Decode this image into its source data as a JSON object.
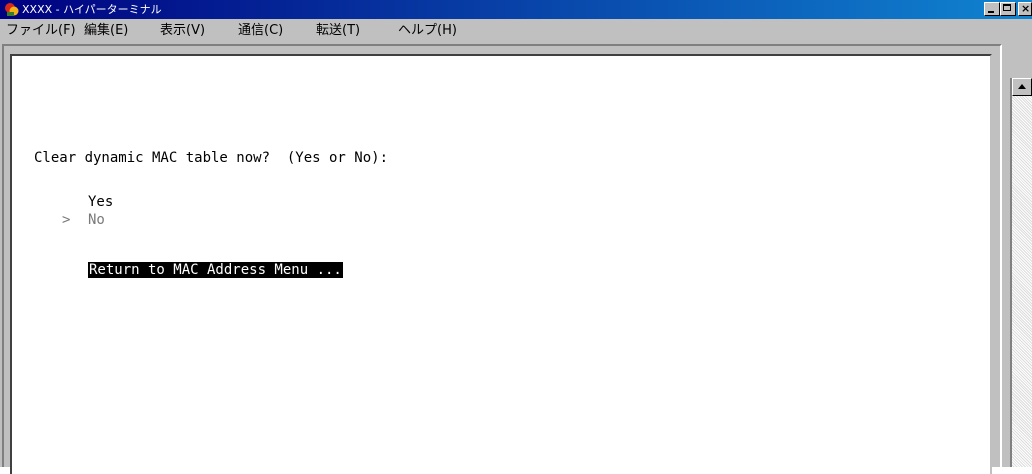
{
  "window": {
    "title": "XXXX - ハイパーターミナル",
    "icon": "hyperterminal-app-icon",
    "controls": {
      "minimize": "minimize-icon",
      "maximize": "maximize-icon",
      "close_glyph": "×"
    }
  },
  "menu": {
    "items": [
      {
        "label": "ファイル(F)"
      },
      {
        "label": "編集(E)"
      },
      {
        "label": "表示(V)"
      },
      {
        "label": "通信(C)"
      },
      {
        "label": "転送(T)"
      },
      {
        "label": "ヘルプ(H)"
      }
    ]
  },
  "terminal": {
    "prompt": "Clear dynamic MAC table now?  (Yes or No):",
    "options": [
      {
        "label": "Yes",
        "selected": false
      },
      {
        "label": "No",
        "selected": true
      }
    ],
    "cursor": ">",
    "return_label": "Return to MAC Address Menu ..."
  },
  "colors": {
    "titlebar_start": "#000080",
    "titlebar_end": "#1084d0",
    "chrome": "#c0c0c0",
    "terminal_bg": "#ffffff",
    "highlight_bg": "#000000",
    "highlight_fg": "#ffffff",
    "dim_text": "#7a7a7a"
  }
}
